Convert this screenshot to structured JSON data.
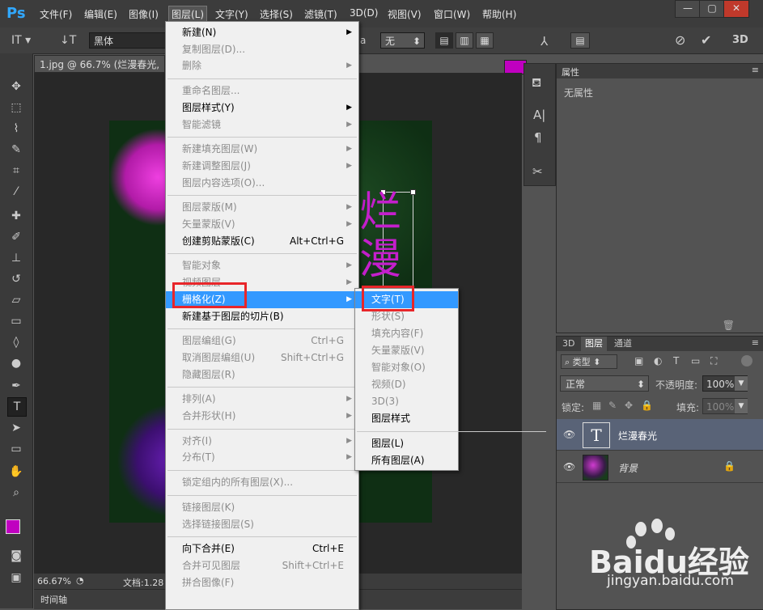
{
  "app": {
    "logo": "Ps"
  },
  "menubar": {
    "items": [
      "文件(F)",
      "编辑(E)",
      "图像(I)",
      "图层(L)",
      "文字(Y)",
      "选择(S)",
      "滤镜(T)",
      "3D(D)",
      "视图(V)",
      "窗口(W)",
      "帮助(H)"
    ],
    "window_buttons": [
      "—",
      "▢",
      "✕"
    ]
  },
  "options_bar": {
    "font_family": "黑体",
    "aa_label": "a",
    "aa_value": "无",
    "text_color": "#c000c0"
  },
  "document": {
    "tab_title": "1.jpg @ 66.7% (烂漫春光, R",
    "zoom": "66.67%",
    "doc_info": "文档:1.28",
    "timeline_label": "时间轴",
    "overlay_chars": [
      "烂",
      "漫"
    ]
  },
  "properties_panel": {
    "title": "属性",
    "content": "无属性"
  },
  "layers_panel": {
    "tabs": [
      "3D",
      "图层",
      "通道"
    ],
    "filter_label": "类型",
    "blend_mode": "正常",
    "opacity_label": "不透明度:",
    "opacity_value": "100%",
    "lock_label": "锁定:",
    "fill_label": "填充:",
    "fill_value": "100%",
    "layers": [
      {
        "name": "烂漫春光",
        "type": "text",
        "thumb": "T"
      },
      {
        "name": "背景",
        "type": "image"
      }
    ]
  },
  "layer_menu": {
    "items": [
      {
        "label": "新建(N)",
        "submenu": true
      },
      {
        "label": "复制图层(D)...",
        "disabled": true
      },
      {
        "label": "删除",
        "disabled": true,
        "submenu": true
      },
      {
        "sep": true
      },
      {
        "label": "重命名图层...",
        "disabled": true
      },
      {
        "label": "图层样式(Y)",
        "submenu": true
      },
      {
        "label": "智能滤镜",
        "disabled": true,
        "submenu": true
      },
      {
        "sep": true
      },
      {
        "label": "新建填充图层(W)",
        "disabled": true,
        "submenu": true
      },
      {
        "label": "新建调整图层(J)",
        "disabled": true,
        "submenu": true
      },
      {
        "label": "图层内容选项(O)...",
        "disabled": true
      },
      {
        "sep": true
      },
      {
        "label": "图层蒙版(M)",
        "disabled": true,
        "submenu": true
      },
      {
        "label": "矢量蒙版(V)",
        "disabled": true,
        "submenu": true
      },
      {
        "label": "创建剪贴蒙版(C)",
        "shortcut": "Alt+Ctrl+G"
      },
      {
        "sep": true
      },
      {
        "label": "智能对象",
        "disabled": true,
        "submenu": true
      },
      {
        "label": "视频图层",
        "disabled": true,
        "submenu": true
      },
      {
        "label": "栅格化(Z)",
        "highlighted": true,
        "submenu": true
      },
      {
        "label": "新建基于图层的切片(B)"
      },
      {
        "sep": true
      },
      {
        "label": "图层编组(G)",
        "disabled": true,
        "shortcut": "Ctrl+G"
      },
      {
        "label": "取消图层编组(U)",
        "disabled": true,
        "shortcut": "Shift+Ctrl+G"
      },
      {
        "label": "隐藏图层(R)",
        "disabled": true
      },
      {
        "sep": true
      },
      {
        "label": "排列(A)",
        "disabled": true,
        "submenu": true
      },
      {
        "label": "合并形状(H)",
        "disabled": true,
        "submenu": true
      },
      {
        "sep": true
      },
      {
        "label": "对齐(I)",
        "disabled": true,
        "submenu": true
      },
      {
        "label": "分布(T)",
        "disabled": true,
        "submenu": true
      },
      {
        "sep": true
      },
      {
        "label": "锁定组内的所有图层(X)...",
        "disabled": true
      },
      {
        "sep": true
      },
      {
        "label": "链接图层(K)",
        "disabled": true
      },
      {
        "label": "选择链接图层(S)",
        "disabled": true
      },
      {
        "sep": true
      },
      {
        "label": "向下合并(E)",
        "shortcut": "Ctrl+E"
      },
      {
        "label": "合并可见图层",
        "disabled": true,
        "shortcut": "Shift+Ctrl+E"
      },
      {
        "label": "拼合图像(F)",
        "disabled": true
      }
    ]
  },
  "rasterize_submenu": {
    "items": [
      {
        "label": "文字(T)",
        "highlighted": true
      },
      {
        "label": "形状(S)",
        "disabled": true
      },
      {
        "label": "填充内容(F)",
        "disabled": true
      },
      {
        "label": "矢量蒙版(V)",
        "disabled": true
      },
      {
        "label": "智能对象(O)",
        "disabled": true
      },
      {
        "label": "视频(D)",
        "disabled": true
      },
      {
        "label": "3D(3)",
        "disabled": true
      },
      {
        "label": "图层样式"
      },
      {
        "sep": true
      },
      {
        "label": "图层(L)"
      },
      {
        "label": "所有图层(A)"
      }
    ]
  },
  "watermark": {
    "brand": "Baidu经验",
    "url": "jingyan.baidu.com"
  }
}
